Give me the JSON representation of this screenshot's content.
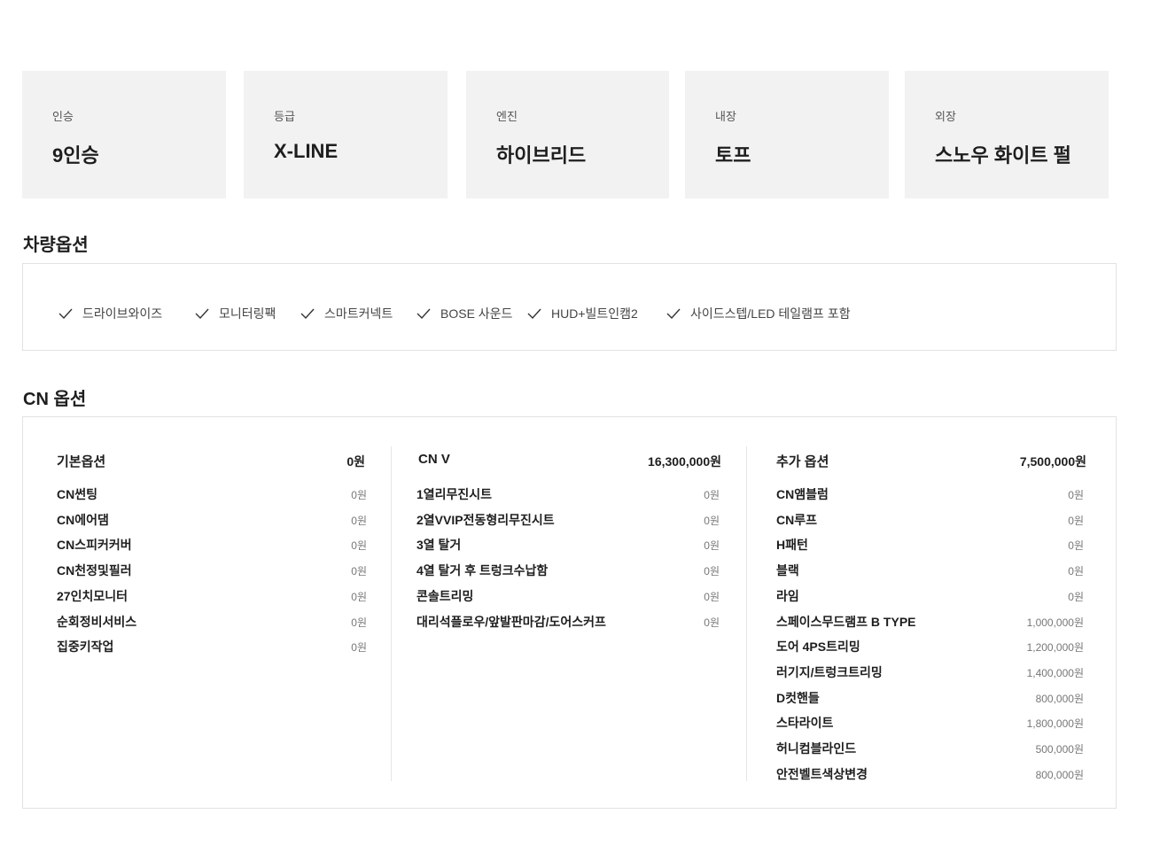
{
  "summary": [
    {
      "label": "인승",
      "value": "9인승"
    },
    {
      "label": "등급",
      "value": "X-LINE"
    },
    {
      "label": "엔진",
      "value": "하이브리드"
    },
    {
      "label": "내장",
      "value": "토프"
    },
    {
      "label": "외장",
      "value": "스노우 화이트 펄"
    }
  ],
  "vehicle_options": {
    "title": "차량옵션",
    "items": [
      "드라이브와이즈",
      "모니터링팩",
      "스마트커넥트",
      "BOSE 사운드",
      "HUD+빌트인캠2",
      "사이드스텝/LED 테일램프 포함"
    ]
  },
  "cn_options": {
    "title": "CN 옵션",
    "columns": [
      {
        "name": "기본옵션",
        "total": "0원",
        "items": [
          {
            "name": "CN썬팅",
            "price": "0원"
          },
          {
            "name": "CN에어댐",
            "price": "0원"
          },
          {
            "name": "CN스피커커버",
            "price": "0원"
          },
          {
            "name": "CN천정및필러",
            "price": "0원"
          },
          {
            "name": "27인치모니터",
            "price": "0원"
          },
          {
            "name": "순회정비서비스",
            "price": "0원"
          },
          {
            "name": "집중키작업",
            "price": "0원"
          }
        ]
      },
      {
        "name": "CN V",
        "total": "16,300,000원",
        "items": [
          {
            "name": "1열리무진시트",
            "price": "0원"
          },
          {
            "name": "2열VVIP전동형리무진시트",
            "price": "0원"
          },
          {
            "name": "3열 탈거",
            "price": "0원"
          },
          {
            "name": "4열 탈거 후 트렁크수납함",
            "price": "0원"
          },
          {
            "name": "콘솔트리밍",
            "price": "0원"
          },
          {
            "name": "대리석플로우/앞발판마감/도어스커프",
            "price": "0원"
          }
        ]
      },
      {
        "name": "추가 옵션",
        "total": "7,500,000원",
        "items": [
          {
            "name": "CN앰블럼",
            "price": "0원"
          },
          {
            "name": "CN루프",
            "price": "0원"
          },
          {
            "name": "H패턴",
            "price": "0원"
          },
          {
            "name": "블랙",
            "price": "0원"
          },
          {
            "name": "라임",
            "price": "0원"
          },
          {
            "name": "스페이스무드램프 B TYPE",
            "price": "1,000,000원"
          },
          {
            "name": "도어 4PS트리밍",
            "price": "1,200,000원"
          },
          {
            "name": "러기지/트렁크트리밍",
            "price": "1,400,000원"
          },
          {
            "name": "D컷핸들",
            "price": "800,000원"
          },
          {
            "name": "스타라이트",
            "price": "1,800,000원"
          },
          {
            "name": "허니컴블라인드",
            "price": "500,000원"
          },
          {
            "name": "안전벨트색상변경",
            "price": "800,000원"
          }
        ]
      }
    ]
  },
  "icons": {
    "check": "check-icon"
  }
}
